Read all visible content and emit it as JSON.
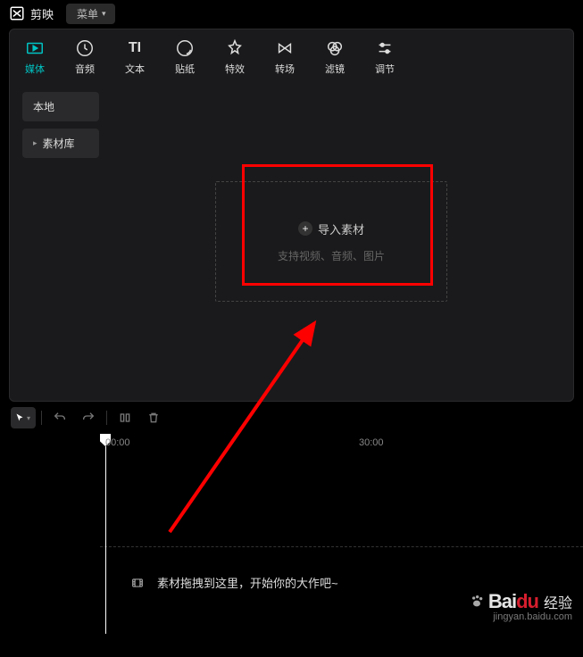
{
  "titlebar": {
    "app_name": "剪映",
    "menu_label": "菜单"
  },
  "toolbar": {
    "items": [
      {
        "id": "media",
        "label": "媒体",
        "active": true
      },
      {
        "id": "audio",
        "label": "音频"
      },
      {
        "id": "text",
        "label": "文本"
      },
      {
        "id": "sticker",
        "label": "贴纸"
      },
      {
        "id": "effect",
        "label": "特效"
      },
      {
        "id": "transition",
        "label": "转场"
      },
      {
        "id": "filter",
        "label": "滤镜"
      },
      {
        "id": "adjust",
        "label": "调节"
      }
    ]
  },
  "sidebar": {
    "items": [
      {
        "id": "local",
        "label": "本地",
        "is_parent": false
      },
      {
        "id": "library",
        "label": "素材库",
        "is_parent": true
      }
    ]
  },
  "dropzone": {
    "import_label": "导入素材",
    "support_label": "支持视频、音频、图片"
  },
  "timeline": {
    "labels": [
      "00:00",
      "30:00"
    ],
    "drop_hint": "素材拖拽到这里，开始你的大作吧~"
  },
  "watermark": {
    "brand_prefix": "Bai",
    "brand_suffix": "du",
    "product": "经验",
    "url": "jingyan.baidu.com"
  }
}
